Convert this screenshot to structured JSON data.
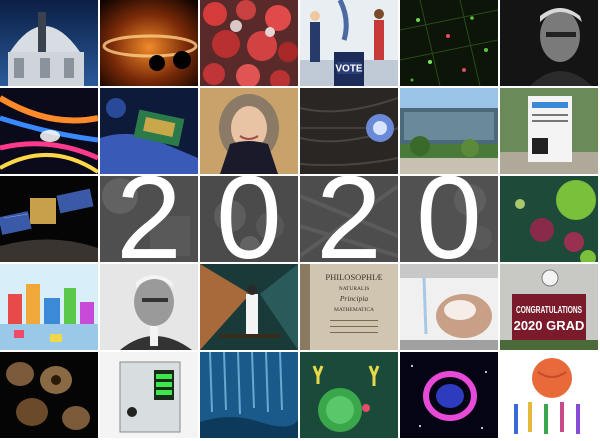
{
  "collage": {
    "year_digits": [
      "2",
      "0",
      "2",
      "0"
    ],
    "tiles": [
      {
        "row": 1,
        "col": 1,
        "subject": "observatory-dome"
      },
      {
        "row": 1,
        "col": 2,
        "subject": "black-hole-disk"
      },
      {
        "row": 1,
        "col": 3,
        "subject": "coronavirus-cluster"
      },
      {
        "row": 1,
        "col": 4,
        "subject": "voting-illustration"
      },
      {
        "row": 1,
        "col": 5,
        "subject": "neuron-micrograph"
      },
      {
        "row": 1,
        "col": 6,
        "subject": "portrait-man-dark"
      },
      {
        "row": 2,
        "col": 1,
        "subject": "light-streaks"
      },
      {
        "row": 2,
        "col": 2,
        "subject": "chip-in-gloved-hand"
      },
      {
        "row": 2,
        "col": 3,
        "subject": "portrait-woman-smiling"
      },
      {
        "row": 2,
        "col": 4,
        "subject": "cell-in-tissue"
      },
      {
        "row": 2,
        "col": 5,
        "subject": "campus-building"
      },
      {
        "row": 2,
        "col": 6,
        "subject": "campus-sign"
      },
      {
        "row": 3,
        "col": 1,
        "subject": "satellite-solar-panels"
      },
      {
        "row": 3,
        "col": 6,
        "subject": "green-virus-particles"
      },
      {
        "row": 4,
        "col": 1,
        "subject": "colorful-city-illustration"
      },
      {
        "row": 4,
        "col": 2,
        "subject": "portrait-older-man-bw"
      },
      {
        "row": 4,
        "col": 3,
        "subject": "scientist-in-lab-illustration"
      },
      {
        "row": 4,
        "col": 4,
        "subject": "principia-book"
      },
      {
        "row": 4,
        "col": 5,
        "subject": "hand-washing"
      },
      {
        "row": 4,
        "col": 6,
        "subject": "graduation-sign"
      },
      {
        "row": 5,
        "col": 1,
        "subject": "brown-blob-shapes"
      },
      {
        "row": 5,
        "col": 2,
        "subject": "lab-equipment"
      },
      {
        "row": 5,
        "col": 3,
        "subject": "coral-reef"
      },
      {
        "row": 5,
        "col": 4,
        "subject": "virus-with-antibodies"
      },
      {
        "row": 5,
        "col": 5,
        "subject": "nebula-ring"
      },
      {
        "row": 5,
        "col": 6,
        "subject": "people-holding-globe-illustration"
      }
    ],
    "visible_text": {
      "vote_sign": "VOTE",
      "grad_sign_top": "CONGRATULATIONS",
      "grad_sign_bottom": "2020 GRAD",
      "book_title_line1": "PHILOSOPHIÆ",
      "book_title_line2": "NATURALIS",
      "book_title_line3": "Principia",
      "book_title_line4": "MATHEMATICA"
    },
    "colors": {
      "background": "#ffffff",
      "digit_text": "#ffffff",
      "gray_band": "#6a6a6a"
    }
  }
}
